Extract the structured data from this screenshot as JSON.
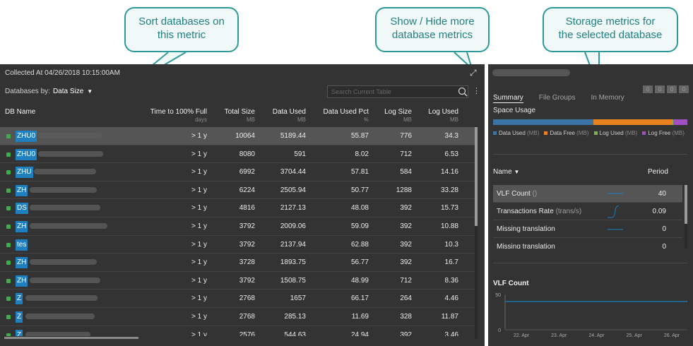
{
  "callouts": {
    "sort": [
      "Sort databases on",
      "this metric"
    ],
    "toggle": [
      "Show / Hide more",
      "database metrics"
    ],
    "storage": [
      "Storage metrics for",
      "the selected database"
    ]
  },
  "header": {
    "collected": "Collected At 04/26/2018 10:15:00AM",
    "sort_label": "Databases by:",
    "sort_value": "Data Size",
    "search_placeholder": "Search Current Table"
  },
  "columns": [
    {
      "label": "DB Name",
      "unit": ""
    },
    {
      "label": "Time to 100% Full",
      "unit": "days"
    },
    {
      "label": "Total Size",
      "unit": "MB"
    },
    {
      "label": "Data Used",
      "unit": "MB"
    },
    {
      "label": "Data Used Pct",
      "unit": "%"
    },
    {
      "label": "Log Size",
      "unit": "MB"
    },
    {
      "label": "Log Used",
      "unit": "MB"
    }
  ],
  "rows": [
    {
      "name": "ZHU0",
      "time": "> 1 y",
      "total": "10064",
      "used": "5189.44",
      "pct": "55.87",
      "logsize": "776",
      "logused": "34.3"
    },
    {
      "name": "ZHU0",
      "time": "> 1 y",
      "total": "8080",
      "used": "591",
      "pct": "8.02",
      "logsize": "712",
      "logused": "6.53"
    },
    {
      "name": "ZHU",
      "time": "> 1 y",
      "total": "6992",
      "used": "3704.44",
      "pct": "57.81",
      "logsize": "584",
      "logused": "14.16"
    },
    {
      "name": "ZH",
      "time": "> 1 y",
      "total": "6224",
      "used": "2505.94",
      "pct": "50.77",
      "logsize": "1288",
      "logused": "33.28"
    },
    {
      "name": "DS",
      "time": "> 1 y",
      "total": "4816",
      "used": "2127.13",
      "pct": "48.08",
      "logsize": "392",
      "logused": "15.73"
    },
    {
      "name": "ZH",
      "time": "> 1 y",
      "total": "3792",
      "used": "2009.06",
      "pct": "59.09",
      "logsize": "392",
      "logused": "10.88"
    },
    {
      "name": "tes",
      "time": "> 1 y",
      "total": "3792",
      "used": "2137.94",
      "pct": "62.88",
      "logsize": "392",
      "logused": "10.3"
    },
    {
      "name": "ZH",
      "time": "> 1 y",
      "total": "3728",
      "used": "1893.75",
      "pct": "56.77",
      "logsize": "392",
      "logused": "16.7"
    },
    {
      "name": "ZH",
      "time": "> 1 y",
      "total": "3792",
      "used": "1508.75",
      "pct": "48.99",
      "logsize": "712",
      "logused": "8.36"
    },
    {
      "name": "Z",
      "time": "> 1 y",
      "total": "2768",
      "used": "1657",
      "pct": "66.17",
      "logsize": "264",
      "logused": "4.46"
    },
    {
      "name": "Z",
      "time": "> 1 y",
      "total": "2768",
      "used": "285.13",
      "pct": "11.69",
      "logsize": "328",
      "logused": "11.87"
    },
    {
      "name": "Z",
      "time": "> 1 y",
      "total": "2576",
      "used": "544.63",
      "pct": "24.94",
      "logsize": "392",
      "logused": "3.46"
    }
  ],
  "detail": {
    "tabs": [
      "Summary",
      "File Groups",
      "In Memory"
    ],
    "badges": [
      "0",
      "0",
      "0",
      "0"
    ],
    "space_usage_label": "Space Usage",
    "space_usage": [
      {
        "name": "Data Used",
        "unit": "(MB)",
        "fraction": 0.515,
        "color": "#3b74a5"
      },
      {
        "name": "Data Free",
        "unit": "(MB)",
        "fraction": 0.41,
        "color": "#e8821e"
      },
      {
        "name": "Log Used",
        "unit": "(MB)",
        "fraction": 0.003,
        "color": "#7ab648"
      },
      {
        "name": "Log Free",
        "unit": "(MB)",
        "fraction": 0.072,
        "color": "#a24fc4"
      }
    ],
    "metrics_header": {
      "name": "Name",
      "period": "Period"
    },
    "metrics": [
      {
        "label": "VLF Count",
        "unit": "()",
        "value": "40"
      },
      {
        "label": "Transactions Rate",
        "unit": "(trans/s)",
        "value": "0.09"
      },
      {
        "label": "Missing translation",
        "unit": "",
        "value": "0"
      },
      {
        "label": "Missing translation",
        "unit": "",
        "value": "0"
      }
    ]
  },
  "chart_data": {
    "type": "line",
    "title": "VLF Count",
    "x": [
      "22. Apr",
      "23. Apr",
      "24. Apr",
      "25. Apr",
      "26. Apr"
    ],
    "ylim": [
      0,
      50
    ],
    "yticks": [
      "0",
      "50"
    ],
    "series": [
      {
        "values": [
          40,
          40,
          40,
          40,
          40
        ],
        "color": "#1f7fbf"
      }
    ]
  },
  "colors": {
    "accent": "#1f7fbf",
    "panel": "#333333",
    "callout_border": "#2e9b9b",
    "status_ok": "#3fae49"
  }
}
